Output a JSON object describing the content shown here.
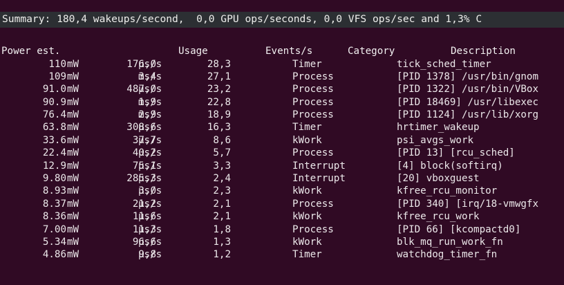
{
  "summary": "Summary: 180,4 wakeups/second,  0,0 GPU ops/seconds, 0,0 VFS ops/sec and 1,3% C",
  "headers": {
    "power": "Power est.",
    "usage": "Usage",
    "events": "Events/s",
    "category": "Category",
    "description": "Description"
  },
  "rows": [
    {
      "power": "110",
      "unit": "mW",
      "rate": "176,0",
      "rate_unit": "µs/s",
      "usage": "28,3",
      "category": "Timer",
      "description": "tick_sched_timer"
    },
    {
      "power": "109",
      "unit": "mW",
      "rate": "3,4",
      "rate_unit": "ms/s",
      "usage": "27,1",
      "category": "Process",
      "description": "[PID 1378] /usr/bin/gnom"
    },
    {
      "power": "91.0",
      "unit": "mW",
      "rate": "487,0",
      "rate_unit": "µs/s",
      "usage": "23,2",
      "category": "Process",
      "description": "[PID 1322] /usr/bin/VBox"
    },
    {
      "power": "90.9",
      "unit": "mW",
      "rate": "1,9",
      "rate_unit": "ms/s",
      "usage": "22,8",
      "category": "Process",
      "description": "[PID 18469] /usr/libexec"
    },
    {
      "power": "76.4",
      "unit": "mW",
      "rate": "2,9",
      "rate_unit": "ms/s",
      "usage": "18,9",
      "category": "Process",
      "description": "[PID 1124] /usr/lib/xorg"
    },
    {
      "power": "63.8",
      "unit": "mW",
      "rate": "308,6",
      "rate_unit": "µs/s",
      "usage": "16,3",
      "category": "Timer",
      "description": "hrtimer_wakeup"
    },
    {
      "power": "33.6",
      "unit": "mW",
      "rate": "37,7",
      "rate_unit": "µs/s",
      "usage": "8,6",
      "category": "kWork",
      "description": "psi_avgs_work"
    },
    {
      "power": "22.4",
      "unit": "mW",
      "rate": "40,2",
      "rate_unit": "µs/s",
      "usage": "5,7",
      "category": "Process",
      "description": "[PID 13] [rcu_sched]"
    },
    {
      "power": "12.9",
      "unit": "mW",
      "rate": "75,1",
      "rate_unit": "µs/s",
      "usage": "3,3",
      "category": "Interrupt",
      "description": "[4] block(softirq)"
    },
    {
      "power": "9.80",
      "unit": "mW",
      "rate": "285,3",
      "rate_unit": "µs/s",
      "usage": "2,4",
      "category": "Interrupt",
      "description": "[20] vboxguest"
    },
    {
      "power": "8.93",
      "unit": "mW",
      "rate": "3,0",
      "rate_unit": "µs/s",
      "usage": "2,3",
      "category": "kWork",
      "description": "kfree_rcu_monitor"
    },
    {
      "power": "8.37",
      "unit": "mW",
      "rate": "21,2",
      "rate_unit": "µs/s",
      "usage": "2,1",
      "category": "Process",
      "description": "[PID 340] [irq/18-vmwgfx"
    },
    {
      "power": "8.36",
      "unit": "mW",
      "rate": "11,6",
      "rate_unit": "µs/s",
      "usage": "2,1",
      "category": "kWork",
      "description": "kfree_rcu_work"
    },
    {
      "power": "7.00",
      "unit": "mW",
      "rate": "11,3",
      "rate_unit": "µs/s",
      "usage": "1,8",
      "category": "Process",
      "description": "[PID 66] [kcompactd0]"
    },
    {
      "power": "5.34",
      "unit": "mW",
      "rate": "96,6",
      "rate_unit": "µs/s",
      "usage": "1,3",
      "category": "kWork",
      "description": "blk_mq_run_work_fn"
    },
    {
      "power": "4.86",
      "unit": "mW",
      "rate": "9,8",
      "rate_unit": "µs/s",
      "usage": "1,2",
      "category": "Timer",
      "description": "watchdog_timer_fn"
    }
  ]
}
